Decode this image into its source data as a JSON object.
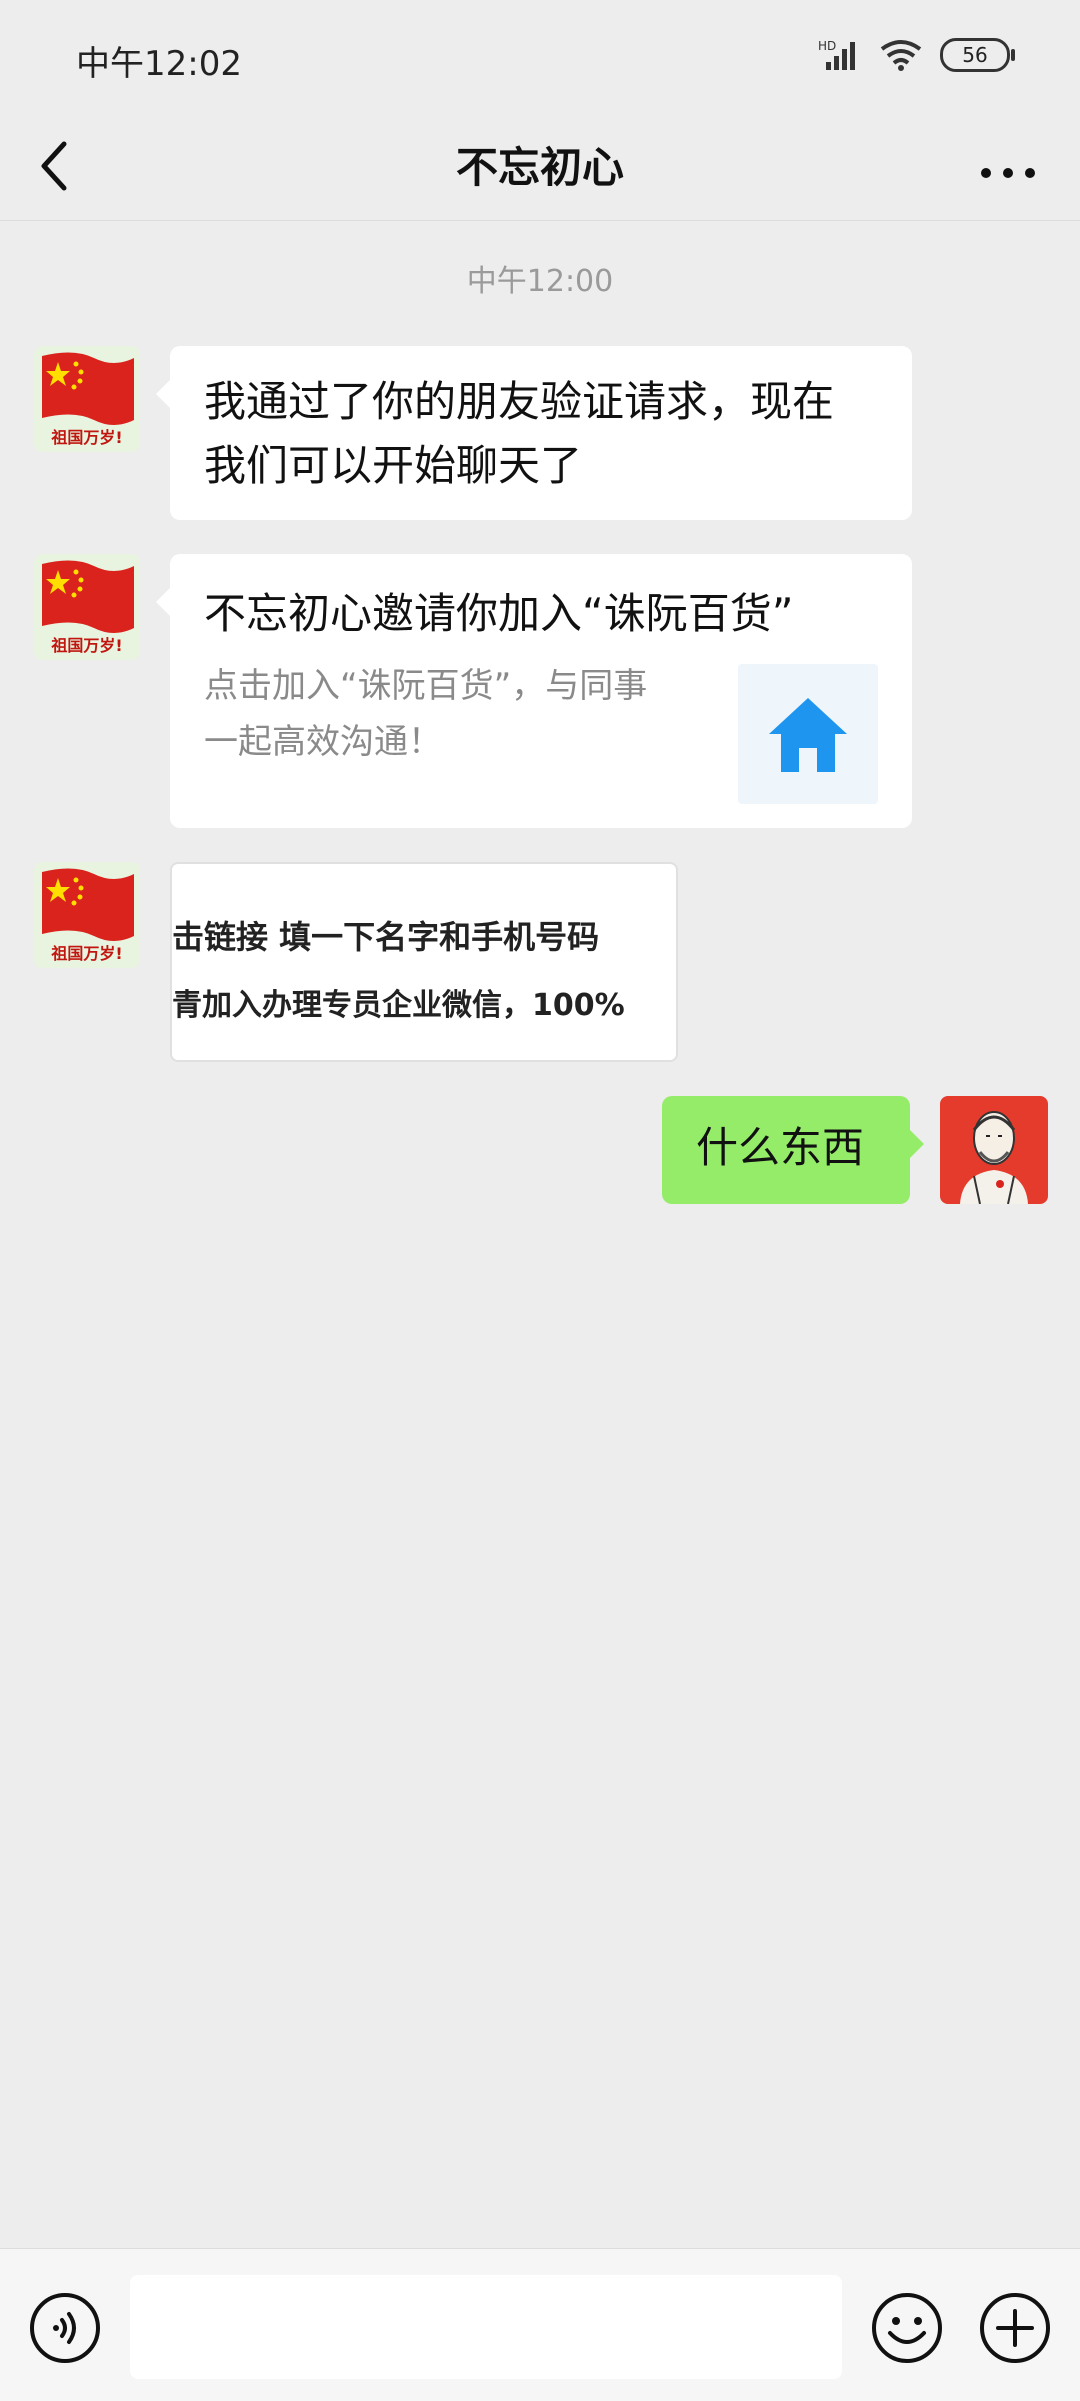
{
  "status_bar": {
    "time": "中午12:02",
    "battery": "56",
    "signal_icon": "signal-hd-icon",
    "wifi_icon": "wifi-icon"
  },
  "header": {
    "title": "不忘初心",
    "back_icon": "chevron-left-icon",
    "more_icon": "more-dots-icon"
  },
  "chat": {
    "timestamp": "中午12:00",
    "messages": [
      {
        "side": "left",
        "type": "text",
        "text_line1": "我通过了你的朋友验证请求，现在",
        "text_line2": "我们可以开始聊天了"
      },
      {
        "side": "left",
        "type": "invite-card",
        "title": "不忘初心邀请你加入“诛阮百货”",
        "desc_line1": "点击加入“诛阮百货”，与同事",
        "desc_line2": "一起高效沟通！",
        "icon": "home-icon"
      },
      {
        "side": "left",
        "type": "image",
        "line1": "击链接  填一下名字和手机号码",
        "line2": "青加入办理专员企业微信，100%"
      },
      {
        "side": "right",
        "type": "text",
        "text": "什么东西"
      }
    ],
    "avatar_left_caption": "祖国万岁!"
  },
  "input_bar": {
    "placeholder": "",
    "voice_icon": "voice-icon",
    "emoji_icon": "emoji-icon",
    "plus_icon": "plus-icon"
  },
  "colors": {
    "background": "#ededed",
    "bubble_self": "#95ec69",
    "bubble_other": "#ffffff",
    "accent_blue": "#1e96f0"
  }
}
